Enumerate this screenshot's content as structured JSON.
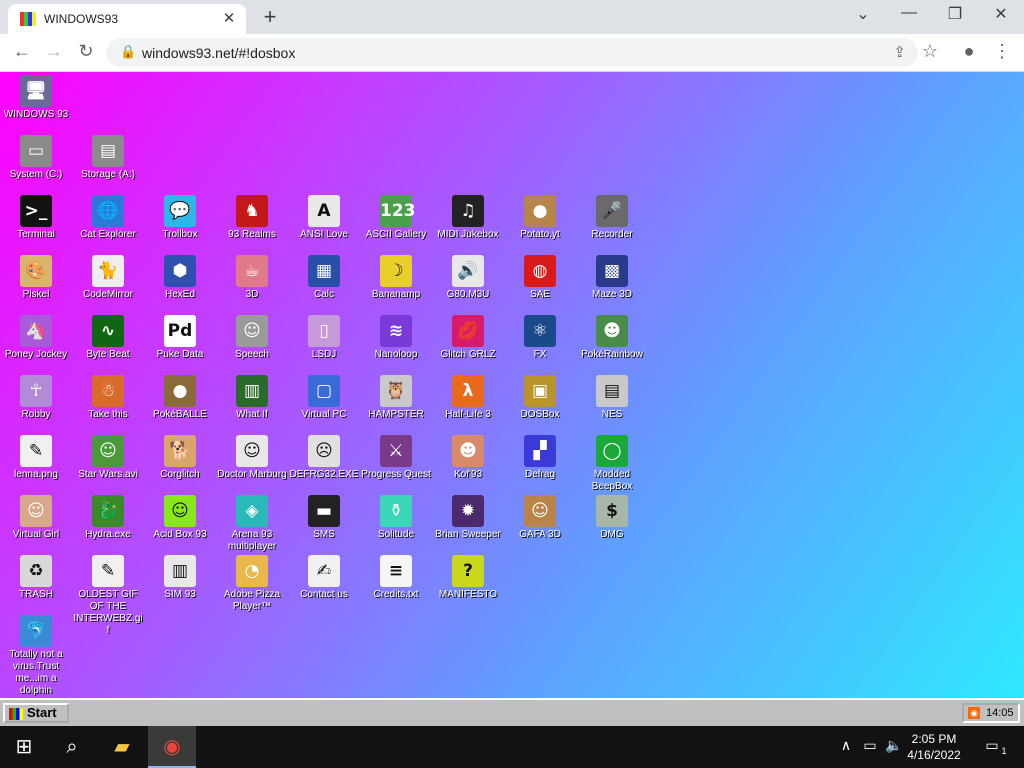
{
  "browser": {
    "tab_title": "WINDOWS93",
    "tab_close": "✕",
    "new_tab": "+",
    "url": "windows93.net/#!dosbox",
    "controls": {
      "dropdown": "⌄",
      "minimize": "—",
      "restore": "❐",
      "close": "✕"
    },
    "nav": {
      "back": "←",
      "forward": "→",
      "reload": "↻"
    },
    "icons": {
      "lock": "🔒",
      "share": "⇪",
      "star": "☆",
      "profile": "●",
      "menu": "⋮"
    }
  },
  "desktop": {
    "icons": [
      {
        "label": "WINDOWS 93",
        "icon": "computer-icon",
        "glyph": "🖥",
        "color": "#6a6a9a"
      },
      {
        "label": "System (C:)",
        "icon": "drive-icon",
        "glyph": "▭",
        "color": "#8a8a8a"
      },
      {
        "label": "Storage (A:)",
        "icon": "floppy-drive-icon",
        "glyph": "▤",
        "color": "#8a8a8a"
      },
      {
        "label": "Terminal",
        "icon": "terminal-icon",
        "glyph": ">_",
        "color": "#111111"
      },
      {
        "label": "Cat Explorer",
        "icon": "globe-cat-icon",
        "glyph": "🌐",
        "color": "#2a7ad6"
      },
      {
        "label": "Trollbox",
        "icon": "chat-bubble-icon",
        "glyph": "💬",
        "color": "#2eb6e6"
      },
      {
        "label": "93 Realms",
        "icon": "red-figure-icon",
        "glyph": "♞",
        "color": "#c21818"
      },
      {
        "label": "ANSI Love",
        "icon": "letter-a-icon",
        "glyph": "A",
        "color": "#e8e8e8"
      },
      {
        "label": "ASCII Gallery",
        "icon": "numbers-icon",
        "glyph": "123",
        "color": "#4aa04a"
      },
      {
        "label": "MIDI Jukebox",
        "icon": "piano-keys-icon",
        "glyph": "♫",
        "color": "#222222"
      },
      {
        "label": "Potato.yt",
        "icon": "potato-icon",
        "glyph": "●",
        "color": "#b5854a"
      },
      {
        "label": "Recorder",
        "icon": "microphone-icon",
        "glyph": "🎤",
        "color": "#6a6a6a"
      },
      {
        "label": "Piskel",
        "icon": "paint-palette-icon",
        "glyph": "🎨",
        "color": "#d8b56a"
      },
      {
        "label": "CodeMirror",
        "icon": "cat-icon",
        "glyph": "🐈",
        "color": "#eeeeee"
      },
      {
        "label": "HexEd",
        "icon": "cube-icon",
        "glyph": "⬢",
        "color": "#3050b0"
      },
      {
        "label": "3D",
        "icon": "teapot-icon",
        "glyph": "☕",
        "color": "#e07a8a"
      },
      {
        "label": "Calc",
        "icon": "calculator-icon",
        "glyph": "▦",
        "color": "#2a4fa8"
      },
      {
        "label": "Bananamp",
        "icon": "banana-icon",
        "glyph": "☽",
        "color": "#e8cf2a"
      },
      {
        "label": "G80.M3U",
        "icon": "speaker-file-icon",
        "glyph": "🔊",
        "color": "#e8e8e8"
      },
      {
        "label": "SAE",
        "icon": "checkered-ball-icon",
        "glyph": "◍",
        "color": "#d81a1a"
      },
      {
        "label": "Maze 3D",
        "icon": "maze-icon",
        "glyph": "▩",
        "color": "#2a3a8a"
      },
      {
        "label": "Poney Jockey",
        "icon": "pony-icon",
        "glyph": "🦄",
        "color": "#a85ad8"
      },
      {
        "label": "Byte Beat",
        "icon": "green-wave-icon",
        "glyph": "∿",
        "color": "#116611"
      },
      {
        "label": "Puke Data",
        "icon": "pd-icon",
        "glyph": "Pd",
        "color": "#ffffff"
      },
      {
        "label": "Speech",
        "icon": "face-icon",
        "glyph": "☺",
        "color": "#9a9a9a"
      },
      {
        "label": "LSDJ",
        "icon": "gameboy-icon",
        "glyph": "▯",
        "color": "#c69ad8"
      },
      {
        "label": "Nanoloop",
        "icon": "purple-wave-icon",
        "glyph": "≋",
        "color": "#7a3ad8"
      },
      {
        "label": "Glitch GRLZ",
        "icon": "lips-icon",
        "glyph": "💋",
        "color": "#d81a6a"
      },
      {
        "label": "FX",
        "icon": "atom-icon",
        "glyph": "⚛",
        "color": "#1a4a8a"
      },
      {
        "label": "PokéRainbow",
        "icon": "trainers-icon",
        "glyph": "☻",
        "color": "#4a8a4a"
      },
      {
        "label": "Robby",
        "icon": "stick-figure-icon",
        "glyph": "☥",
        "color": "#b38ad8"
      },
      {
        "label": "Take this",
        "icon": "old-man-icon",
        "glyph": "☃",
        "color": "#d86a2a"
      },
      {
        "label": "PokéBALLE",
        "icon": "pouch-icon",
        "glyph": "●",
        "color": "#8a6a3a"
      },
      {
        "label": "What If",
        "icon": "graph-icon",
        "glyph": "▥",
        "color": "#2a6a2a"
      },
      {
        "label": "Virtual PC",
        "icon": "window-cursor-icon",
        "glyph": "▢",
        "color": "#3a6ad8"
      },
      {
        "label": "HAMPSTER",
        "icon": "owl-icon",
        "glyph": "🦉",
        "color": "#c9c9c9"
      },
      {
        "label": "Half-Life 3",
        "icon": "lambda-icon",
        "glyph": "λ",
        "color": "#e86a1a"
      },
      {
        "label": "DOSBox",
        "icon": "dosbox-icon",
        "glyph": "▣",
        "color": "#b8942a"
      },
      {
        "label": "NES",
        "icon": "nes-console-icon",
        "glyph": "▤",
        "color": "#c9c9c9"
      },
      {
        "label": "lenna.png",
        "icon": "image-file-icon",
        "glyph": "✎",
        "color": "#f0f0f0"
      },
      {
        "label": "Star Wars.avi",
        "icon": "yoda-icon",
        "glyph": "☺",
        "color": "#4a9a3a"
      },
      {
        "label": "Corglitch",
        "icon": "corgi-icon",
        "glyph": "🐕",
        "color": "#d8a56a"
      },
      {
        "label": "Doctor Marburg",
        "icon": "doctor-icon",
        "glyph": "☺",
        "color": "#e8e8e8"
      },
      {
        "label": "DEFRG32.EXE",
        "icon": "monitor-face-icon",
        "glyph": "☹",
        "color": "#e0e0e0"
      },
      {
        "label": "Progress Quest",
        "icon": "crossed-swords-icon",
        "glyph": "⚔",
        "color": "#7a3a8a"
      },
      {
        "label": "Kof'93",
        "icon": "fighter-icon",
        "glyph": "☻",
        "color": "#d88a6a"
      },
      {
        "label": "Defrag",
        "icon": "defrag-blocks-icon",
        "glyph": "▞",
        "color": "#3a3ad8"
      },
      {
        "label": "Modded BeepBox",
        "icon": "green-ring-icon",
        "glyph": "◯",
        "color": "#1aa83a"
      },
      {
        "label": "Virtual Girl",
        "icon": "portrait-icon",
        "glyph": "☺",
        "color": "#d8a88a"
      },
      {
        "label": "Hydra.exe",
        "icon": "hydra-icon",
        "glyph": "🐉",
        "color": "#3a8a2a"
      },
      {
        "label": "Acid Box 93",
        "icon": "smiley-icon",
        "glyph": "☺",
        "color": "#8ae81a"
      },
      {
        "label": "Arena 93 multiplayer",
        "icon": "colored-cube-icon",
        "glyph": "◈",
        "color": "#2ab8b8"
      },
      {
        "label": "SMS",
        "icon": "sega-console-icon",
        "glyph": "▬",
        "color": "#222222"
      },
      {
        "label": "Solitude",
        "icon": "bottle-icon",
        "glyph": "⚱",
        "color": "#3ad8b8"
      },
      {
        "label": "Brian Sweeper",
        "icon": "mine-icon",
        "glyph": "✹",
        "color": "#4a2a6a"
      },
      {
        "label": "GAFA 3D",
        "icon": "doom-face-icon",
        "glyph": "☺",
        "color": "#b8844a"
      },
      {
        "label": "DMG",
        "icon": "dollar-bills-icon",
        "glyph": "$",
        "color": "#a8b8a8"
      },
      {
        "label": "TRASH",
        "icon": "trash-icon",
        "glyph": "♻",
        "color": "#d8d8d8"
      },
      {
        "label": "OLDEST GIF OF THE INTERWEBZ.gif",
        "icon": "gif-file-icon",
        "glyph": "✎",
        "color": "#f0f0f0"
      },
      {
        "label": "SIM 93",
        "icon": "book-icon",
        "glyph": "▥",
        "color": "#e8e8e8"
      },
      {
        "label": "Adobe Pizza Player™",
        "icon": "pizza-icon",
        "glyph": "◔",
        "color": "#e8b84a"
      },
      {
        "label": "Contact us",
        "icon": "document-pen-icon",
        "glyph": "✍",
        "color": "#f0f0f0"
      },
      {
        "label": "Credits.txt",
        "icon": "text-file-icon",
        "glyph": "≡",
        "color": "#f5f5f5"
      },
      {
        "label": "MANIFESTO",
        "icon": "question-mark-icon",
        "glyph": "?",
        "color": "#c9d81a"
      },
      {
        "label": "Totally not a virus.Trust me...im a dolphin",
        "icon": "dolphin-shortcut-icon",
        "glyph": "🐬",
        "color": "#3a8ad8"
      }
    ]
  },
  "w93_taskbar": {
    "start_label": "Start",
    "rss_glyph": "◉",
    "clock": "14:05"
  },
  "os_taskbar": {
    "start_glyph": "⊞",
    "search_glyph": "⌕",
    "explorer_glyph": "▰",
    "chrome_glyph": "◉",
    "tray_chevron": "∧",
    "network_glyph": "▭",
    "volume_glyph": "🔈",
    "time": "2:05 PM",
    "date": "4/16/2022",
    "notification_glyph": "▭",
    "notification_count": "1"
  }
}
